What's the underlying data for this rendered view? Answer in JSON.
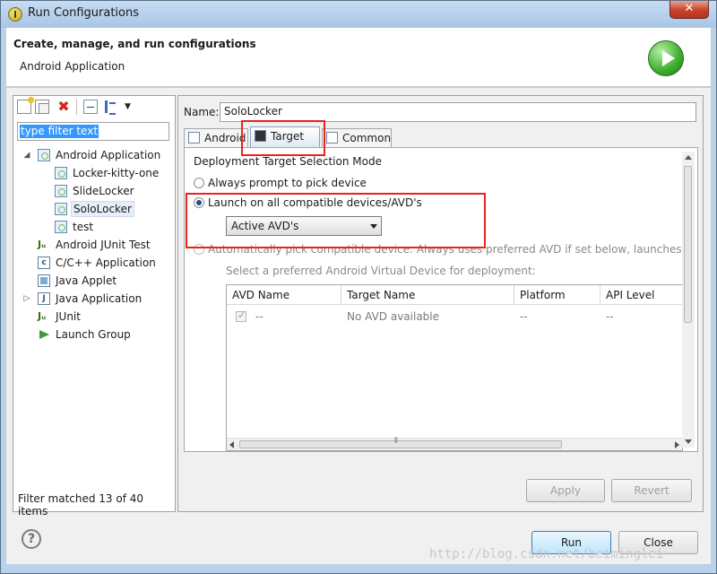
{
  "window": {
    "title": "Run Configurations",
    "close_label": "✕"
  },
  "header": {
    "title": "Create, manage, and run configurations",
    "subtitle": "Android Application"
  },
  "toolbar": {
    "menu_glyph": "▼",
    "delete_glyph": "✖"
  },
  "filter": {
    "placeholder": "type filter text"
  },
  "tree": {
    "items": [
      {
        "label": "Android Application",
        "icon": "android-config-icon",
        "expanded": true
      },
      {
        "label": "Locker-kitty-one",
        "icon": "android-config-icon"
      },
      {
        "label": "SlideLocker",
        "icon": "android-config-icon"
      },
      {
        "label": "SoloLocker",
        "icon": "android-config-icon",
        "selected": true
      },
      {
        "label": "test",
        "icon": "android-config-icon"
      },
      {
        "label": "Android JUnit Test",
        "icon": "junit-icon"
      },
      {
        "label": "C/C++ Application",
        "icon": "c-app-icon"
      },
      {
        "label": "Java Applet",
        "icon": "java-applet-icon"
      },
      {
        "label": "Java Application",
        "icon": "java-app-icon",
        "expanded": false
      },
      {
        "label": "JUnit",
        "icon": "junit-icon"
      },
      {
        "label": "Launch Group",
        "icon": "launch-group-icon"
      }
    ],
    "twisty_open": "◢",
    "twisty_closed": "▷",
    "status": "Filter matched 13 of 40 items"
  },
  "config": {
    "name_label": "Name:",
    "name_value": "SoloLocker",
    "tabs": [
      {
        "label": "Android"
      },
      {
        "label": "Target",
        "active": true
      },
      {
        "label": "Common"
      }
    ],
    "group_title": "Deployment Target Selection Mode",
    "radio_always": "Always prompt to pick device",
    "radio_launch_all": "Launch on all compatible devices/AVD's",
    "select_value": "Active AVD's",
    "radio_auto": "Automatically pick compatible device: Always uses preferred AVD if set below, launches on",
    "avd_hint": "Select a preferred Android Virtual Device for deployment:",
    "avd_columns": [
      "AVD Name",
      "Target Name",
      "Platform",
      "API Level"
    ],
    "avd_row": [
      "--",
      "No AVD available",
      "--",
      "--"
    ],
    "scroll_grip": "⦀"
  },
  "buttons": {
    "apply": "Apply",
    "revert": "Revert",
    "run": "Run",
    "close": "Close",
    "help": "?"
  },
  "watermark": "http://blog.csdn.net/beiminglei",
  "colors": {
    "annotation": "#e8231c",
    "selection": "#3399ff",
    "accent": "#3c7fb1"
  }
}
